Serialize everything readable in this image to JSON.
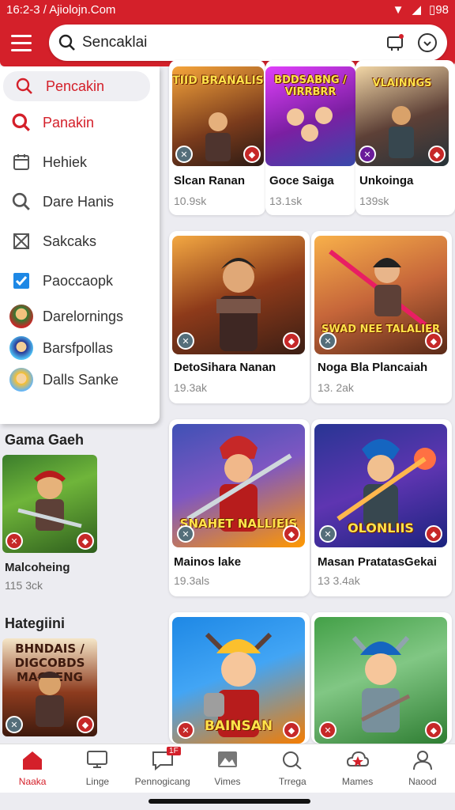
{
  "status_bar": {
    "time_text": "16:2-3 / Ajiolojn.Com",
    "battery": "98"
  },
  "search": {
    "placeholder": "Sencaklai"
  },
  "drawer": {
    "items": [
      {
        "label": "Pencakin",
        "icon": "search-icon"
      },
      {
        "label": "Panakin",
        "icon": "search-icon"
      },
      {
        "label": "Hehiek",
        "icon": "calendar-icon"
      },
      {
        "label": "Dare Hanis",
        "icon": "search-icon"
      },
      {
        "label": "Sakcaks",
        "icon": "crossed-box-icon"
      },
      {
        "label": "Paoccaopk",
        "icon": "checkbox-icon"
      },
      {
        "label": "Darelornings",
        "icon": "avatar"
      },
      {
        "label": "Barsfpollas",
        "icon": "avatar"
      },
      {
        "label": "Dalls Sanke",
        "icon": "avatar"
      }
    ]
  },
  "left_sections": [
    {
      "title": "Gama Gaeh",
      "game": {
        "name": "Malcoheing",
        "meta": "115 3ck"
      }
    },
    {
      "title": "Hategiini",
      "game": {
        "name": "",
        "meta": "",
        "art_text": "BHNDAIS / DIGCOBDS MAGTENG"
      }
    }
  ],
  "top_row": [
    {
      "name": "Slcan Ranan",
      "meta": "10.9sk",
      "art_text": "TIID BRANALIS"
    },
    {
      "name": "Goce Saiga",
      "meta": "13.1sk",
      "art_text": "BDDSABNG / VIRRBRR"
    },
    {
      "name": "Unkoinga",
      "meta": "139sk",
      "art_text": "VLAINNGS"
    }
  ],
  "grid": [
    {
      "name": "DetoSihara Nanan",
      "meta": "19.3ak",
      "art_text": ""
    },
    {
      "name": "Noga Bla Plancaiah",
      "meta": "13. 2ak",
      "art_text": "SWAD NEE TALALIER"
    },
    {
      "name": "Mainos lake",
      "meta": "19.3als",
      "art_text": "SNAHET NALLIEIS"
    },
    {
      "name": "Masan PratatasGekai",
      "meta": "13 3.4ak",
      "art_text": "OLONLIIS"
    },
    {
      "name": "",
      "meta": "",
      "art_text": "BAINSAN"
    },
    {
      "name": "",
      "meta": "",
      "art_text": ""
    }
  ],
  "bottom_nav": [
    {
      "label": "Naaka",
      "icon": "home-icon"
    },
    {
      "label": "Linge",
      "icon": "monitor-icon"
    },
    {
      "label": "Pennogicang",
      "icon": "chat-icon",
      "badge": "1F"
    },
    {
      "label": "Vimes",
      "icon": "image-icon"
    },
    {
      "label": "Trrega",
      "icon": "search-chat-icon"
    },
    {
      "label": "Mames",
      "icon": "star-cloud-icon"
    },
    {
      "label": "Naood",
      "icon": "profile-icon"
    }
  ],
  "colors": {
    "brand": "#d4202a"
  }
}
